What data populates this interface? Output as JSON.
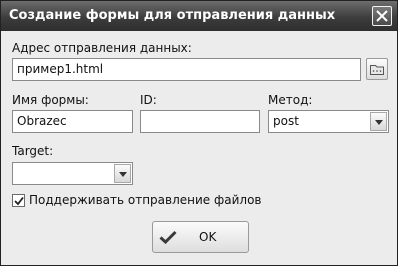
{
  "window": {
    "title": "Создание формы для отправления данных"
  },
  "form": {
    "action_label": "Адрес отправления данных:",
    "action_value": "пример1.html",
    "name_label": "Имя формы:",
    "name_value": "Obrazec",
    "id_label": "ID:",
    "id_value": "",
    "method_label": "Метод:",
    "method_value": "post",
    "target_label": "Target:",
    "target_value": "",
    "upload_label": "Поддерживать отправление файлов",
    "upload_checked": true
  },
  "buttons": {
    "ok_label": "OK"
  },
  "icons": {
    "close": "close-icon",
    "browse": "folder-icon",
    "dropdown": "chevron-down-icon",
    "checkmark": "checkmark-icon"
  }
}
